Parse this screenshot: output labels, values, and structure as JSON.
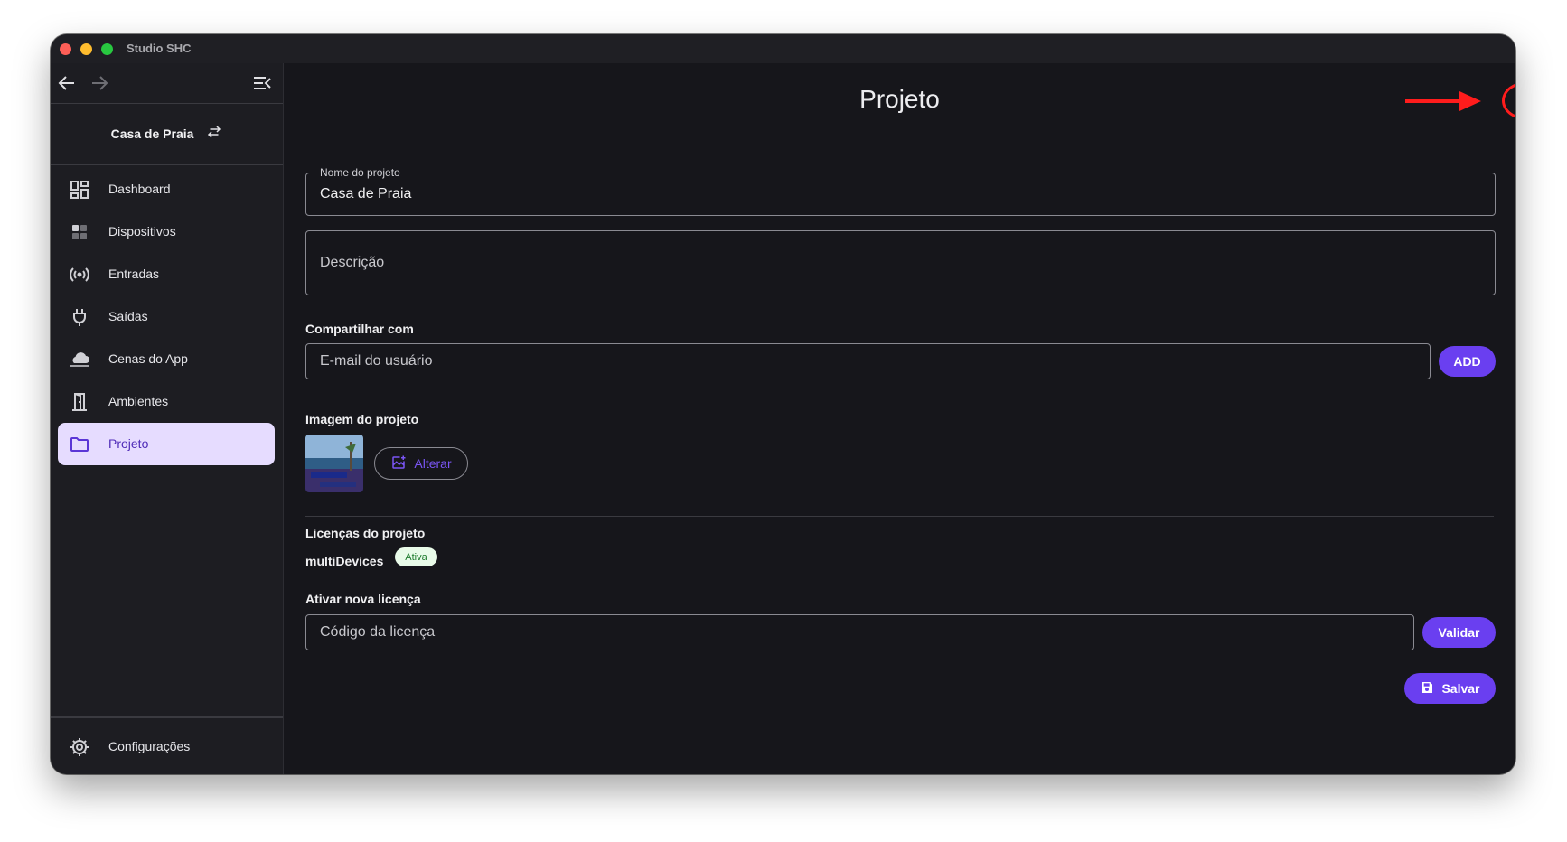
{
  "window": {
    "title": "Studio SHC"
  },
  "sidebar": {
    "project_name": "Casa de Praia",
    "items": [
      {
        "label": "Dashboard"
      },
      {
        "label": "Dispositivos"
      },
      {
        "label": "Entradas"
      },
      {
        "label": "Saídas"
      },
      {
        "label": "Cenas do App"
      },
      {
        "label": "Ambientes"
      },
      {
        "label": "Projeto"
      }
    ],
    "settings_label": "Configurações"
  },
  "main": {
    "title": "Projeto",
    "name_field": {
      "label": "Nome do projeto",
      "value": "Casa de Praia"
    },
    "description_field": {
      "placeholder": "Descrição"
    },
    "share": {
      "label": "Compartilhar com",
      "placeholder": "E-mail do usuário",
      "add_label": "ADD"
    },
    "image": {
      "label": "Imagem do projeto",
      "change_label": "Alterar"
    },
    "licenses": {
      "label": "Licenças do projeto",
      "name": "multiDevices",
      "status": "Ativa"
    },
    "activate": {
      "label": "Ativar nova licença",
      "placeholder": "Código da licença",
      "validate_label": "Validar"
    },
    "save_label": "Salvar"
  },
  "colors": {
    "accent": "#6a3ff0",
    "active_bg": "#e6dcff",
    "annotation": "#ff1c1c",
    "badge_bg": "#e9fbe9"
  }
}
